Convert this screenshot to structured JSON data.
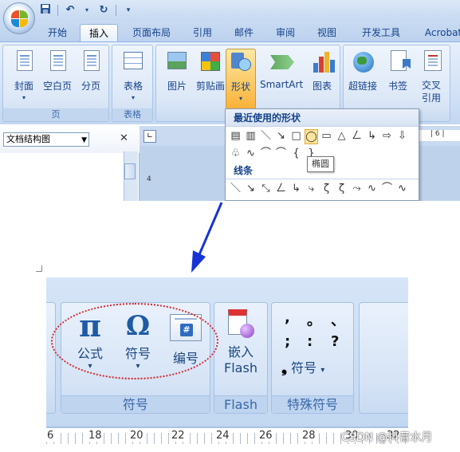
{
  "qat": {
    "save_icon": "save-icon",
    "undo_icon": "undo-icon",
    "redo_icon": "redo-icon"
  },
  "tabs": [
    "开始",
    "插入",
    "页面布局",
    "引用",
    "邮件",
    "审阅",
    "视图",
    "开发工具",
    "Acrobat"
  ],
  "active_tab": "插入",
  "ribbon": {
    "groups": {
      "page": {
        "caption": "页",
        "buttons": [
          "封面",
          "空白页",
          "分页"
        ]
      },
      "table": {
        "caption": "表格",
        "buttons": [
          "表格"
        ]
      },
      "illus": {
        "buttons": [
          "图片",
          "剪贴画",
          "形状",
          "SmartArt",
          "图表"
        ]
      },
      "links": {
        "buttons": [
          "超链接",
          "书签",
          "交叉引用"
        ]
      }
    }
  },
  "docmap": {
    "title": "文档结构图"
  },
  "ruler": {
    "top_right": "| 6 |",
    "vertical": "4"
  },
  "shapes_menu": {
    "recent_header": "最近使用的形状",
    "lines_header": "线条",
    "recent_row1": [
      "▤",
      "▥",
      "＼",
      "↘",
      "□",
      "◯",
      "▭",
      "△",
      "ㄥ",
      "↳",
      "⇨",
      "⇩"
    ],
    "recent_row2": [
      "♧",
      "∿",
      "⌒",
      "⌒",
      "{",
      "}"
    ],
    "lines_row": [
      "＼",
      "↘",
      "⤡",
      "ㄥ",
      "↳",
      "⤷",
      "ζ",
      "ζ",
      "⤳",
      "∿",
      "⌒",
      "∿"
    ],
    "tooltip": "椭圆"
  },
  "zoom": {
    "formula": {
      "symbol": "π",
      "label": "公式"
    },
    "symbol": {
      "symbol": "Ω",
      "label": "符号"
    },
    "number": {
      "symbol": "#",
      "label": "编号"
    },
    "symbols_group_caption": "符号",
    "flash": {
      "label1": "嵌入",
      "label2": "Flash",
      "caption": "Flash"
    },
    "special": {
      "marks": [
        ",",
        "。",
        "、",
        ";",
        ":",
        "?"
      ],
      "label": "符号",
      "caption": "特殊符号"
    },
    "ruler_numbers": [
      "6",
      "18",
      "20",
      "22",
      "24",
      "26",
      "28",
      "30",
      "32"
    ]
  },
  "watermark": "CSDN @抖音水月"
}
